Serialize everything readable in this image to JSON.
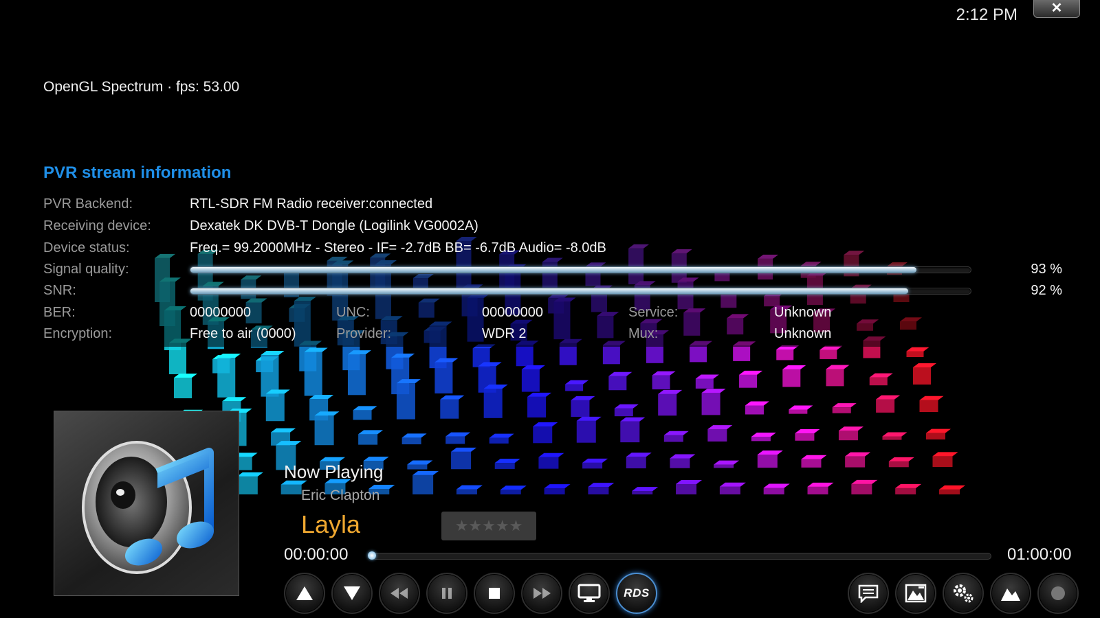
{
  "header": {
    "clock": "2:12 PM",
    "close_label": "✕",
    "fps_info": "OpenGL Spectrum · fps: 53.00"
  },
  "pvr": {
    "title": "PVR stream information",
    "backend_label": "PVR Backend:",
    "backend_value": "RTL-SDR FM Radio receiver:connected",
    "device_label": "Receiving device:",
    "device_value": "Dexatek DK DVB-T Dongle (Logilink VG0002A)",
    "status_label": "Device status:",
    "status_value": "Freq.= 99.2000MHz - Stereo - IF= -2.7dB  BB= -6.7dB  Audio= -8.0dB",
    "signal_label": "Signal quality:",
    "signal_percent": 93,
    "signal_text": "93 %",
    "snr_label": "SNR:",
    "snr_percent": 92,
    "snr_text": "92 %",
    "ber_label": "BER:",
    "ber_value": "00000000",
    "unc_label": "UNC:",
    "unc_value": "00000000",
    "service_label": "Service:",
    "service_value": "Unknown",
    "encryption_label": "Encryption:",
    "encryption_value": "Free to air (0000)",
    "provider_label": "Provider:",
    "provider_value": "WDR 2",
    "mux_label": "Mux:",
    "mux_value": "Unknown"
  },
  "player": {
    "now_playing_label": "Now Playing",
    "artist": "Eric Clapton",
    "title": "Layla",
    "rating_stars": "★★★★★",
    "rating_value": 0,
    "time_current": "00:00:00",
    "time_total": "01:00:00",
    "progress": 0,
    "rds_label": "RDS"
  },
  "controls": {
    "left": [
      "arrow-up-icon",
      "arrow-down-icon",
      "rewind-icon",
      "pause-icon",
      "stop-icon",
      "fast-forward-icon",
      "monitor-icon",
      "rds-icon"
    ],
    "right": [
      "subtitles-icon",
      "visualization-icon",
      "settings-icon",
      "visualization-settings-icon",
      "record-icon"
    ]
  },
  "colors": {
    "accent_blue": "#1f8fe8",
    "song_title": "#f0a830",
    "rds_ring": "#4b8ed0"
  }
}
